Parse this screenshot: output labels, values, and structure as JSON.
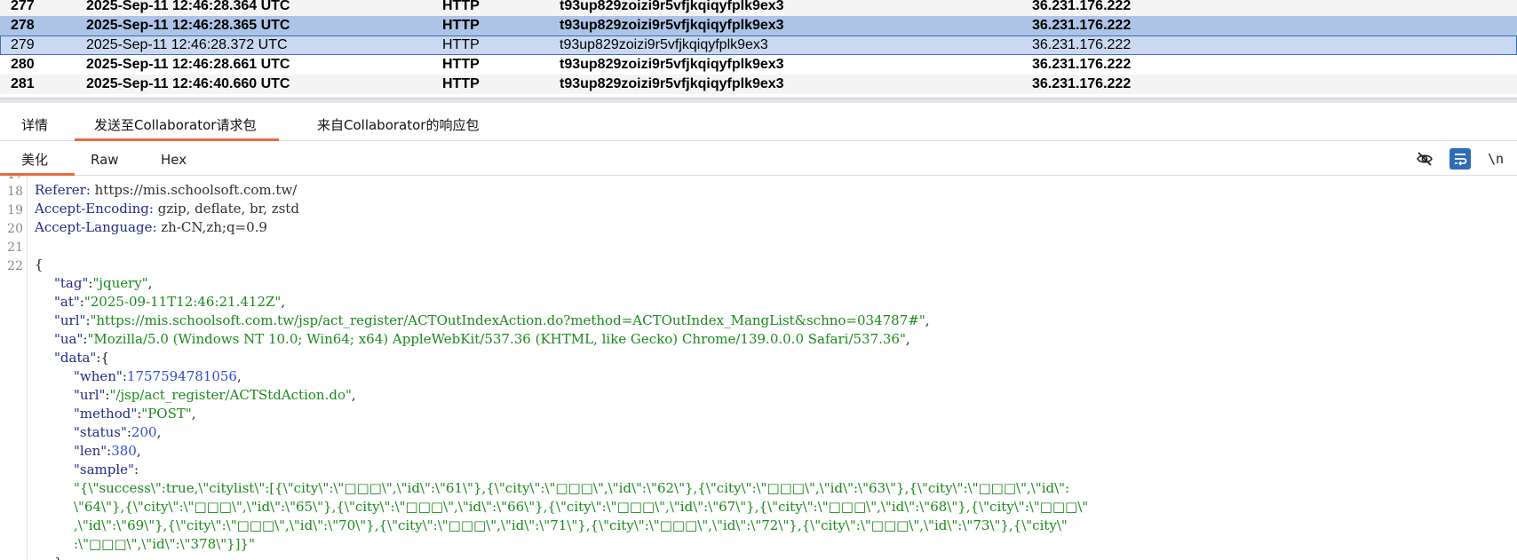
{
  "table": {
    "rows": [
      {
        "num": "277",
        "time": "2025-Sep-11 12:46:28.364 UTC",
        "type": "HTTP",
        "payload": "t93up829zoizi9r5vfjkqiqyfplk9ex3",
        "ip": "36.231.176.222"
      },
      {
        "num": "278",
        "time": "2025-Sep-11 12:46:28.365 UTC",
        "type": "HTTP",
        "payload": "t93up829zoizi9r5vfjkqiqyfplk9ex3",
        "ip": "36.231.176.222"
      },
      {
        "num": "279",
        "time": "2025-Sep-11 12:46:28.372 UTC",
        "type": "HTTP",
        "payload": "t93up829zoizi9r5vfjkqiqyfplk9ex3",
        "ip": "36.231.176.222"
      },
      {
        "num": "280",
        "time": "2025-Sep-11 12:46:28.661 UTC",
        "type": "HTTP",
        "payload": "t93up829zoizi9r5vfjkqiqyfplk9ex3",
        "ip": "36.231.176.222"
      },
      {
        "num": "281",
        "time": "2025-Sep-11 12:46:40.660 UTC",
        "type": "HTTP",
        "payload": "t93up829zoizi9r5vfjkqiqyfplk9ex3",
        "ip": "36.231.176.222"
      }
    ]
  },
  "main_tabs": [
    "详情",
    "发送至Collaborator请求包",
    "来自Collaborator的响应包"
  ],
  "sub_tabs": [
    "美化",
    "Raw",
    "Hex"
  ],
  "toolbar": {
    "newline_label": "\\n",
    "icons": [
      "eye-slash-icon",
      "wrap-text-icon"
    ],
    "accent": "#2d6db5"
  },
  "editor": {
    "line_numbers": [
      "18",
      "19",
      "20",
      "21",
      "22"
    ],
    "headers": [
      {
        "key": "Referer:",
        "value": " https://mis.schoolsoft.com.tw/"
      },
      {
        "key": "Accept-Encoding:",
        "value": " gzip, deflate, br, zstd"
      },
      {
        "key": "Accept-Language:",
        "value": " zh-CN,zh;q=0.9"
      }
    ],
    "json": {
      "open": "{",
      "tag_key": "\"tag\"",
      "tag_val": "\"jquery\"",
      "at_key": "\"at\"",
      "at_val": "\"2025-09-11T12:46:21.412Z\"",
      "url_key": "\"url\"",
      "url_val": "\"https://mis.schoolsoft.com.tw/jsp/act_register/ACTOutIndexAction.do?method=ACTOutIndex_MangList&schno=034787#\"",
      "ua_key": "\"ua\"",
      "ua_val": "\"Mozilla/5.0 (Windows NT 10.0; Win64; x64) AppleWebKit/537.36 (KHTML, like Gecko) Chrome/139.0.0.0 Safari/537.36\"",
      "data_key": "\"data\"",
      "when_key": "\"when\"",
      "when_val": "1757594781056",
      "durl_key": "\"url\"",
      "durl_val": "\"/jsp/act_register/ACTStdAction.do\"",
      "method_key": "\"method\"",
      "method_val": "\"POST\"",
      "status_key": "\"status\"",
      "status_val": "200",
      "len_key": "\"len\"",
      "len_val": "380",
      "sample_key": "\"sample\"",
      "sample_lines": [
        "\"{\\\"success\\\":true,\\\"citylist\\\":[{\\\"city\\\":\\\"□□□\\\",\\\"id\\\":\\\"61\\\"},{\\\"city\\\":\\\"□□□\\\",\\\"id\\\":\\\"62\\\"},{\\\"city\\\":\\\"□□□\\\",\\\"id\\\":\\\"63\\\"},{\\\"city\\\":\\\"□□□\\\",\\\"id\\\":",
        "\\\"64\\\"},{\\\"city\\\":\\\"□□□\\\",\\\"id\\\":\\\"65\\\"},{\\\"city\\\":\\\"□□□\\\",\\\"id\\\":\\\"66\\\"},{\\\"city\\\":\\\"□□□\\\",\\\"id\\\":\\\"67\\\"},{\\\"city\\\":\\\"□□□\\\",\\\"id\\\":\\\"68\\\"},{\\\"city\\\":\\\"□□□\\\"",
        ",\\\"id\\\":\\\"69\\\"},{\\\"city\\\":\\\"□□□\\\",\\\"id\\\":\\\"70\\\"},{\\\"city\\\":\\\"□□□\\\",\\\"id\\\":\\\"71\\\"},{\\\"city\\\":\\\"□□□\\\",\\\"id\\\":\\\"72\\\"},{\\\"city\\\":\\\"□□□\\\",\\\"id\\\":\\\"73\\\"},{\\\"city\\\"",
        ":\\\"□□□\\\",\\\"id\\\":\\\"378\\\"}]}\""
      ],
      "close_data": "}"
    }
  }
}
